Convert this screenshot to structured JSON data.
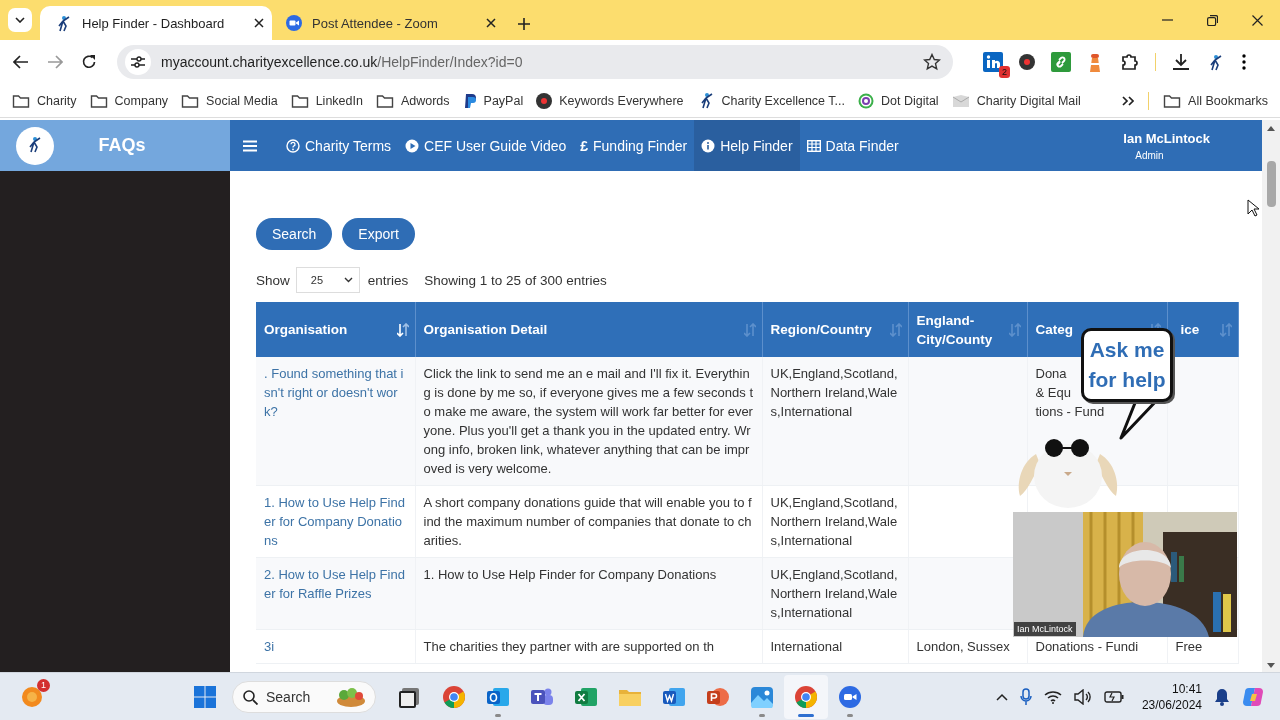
{
  "browser": {
    "tabs": [
      {
        "title": "Help Finder - Dashboard",
        "kind": "figure",
        "selected": true
      },
      {
        "title": "Post Attendee - Zoom",
        "kind": "zoom",
        "selected": false
      }
    ],
    "address": {
      "host": "myaccount.charityexcellence.co.uk",
      "path": "/HelpFinder/Index?id=0"
    },
    "extensions": [
      {
        "kind": "linkedin",
        "badge": "2"
      },
      {
        "kind": "k"
      },
      {
        "kind": "link"
      },
      {
        "kind": "lighthouse"
      },
      {
        "kind": "puzzle"
      }
    ],
    "bookmarks": [
      {
        "label": "Charity",
        "kind": "folder"
      },
      {
        "label": "Company",
        "kind": "folder"
      },
      {
        "label": "Social Media",
        "kind": "folder"
      },
      {
        "label": "LinkedIn",
        "kind": "folder"
      },
      {
        "label": "Adwords",
        "kind": "folder"
      },
      {
        "label": "PayPal",
        "kind": "paypal"
      },
      {
        "label": "Keywords Everywhere",
        "kind": "k"
      },
      {
        "label": "Charity Excellence T...",
        "kind": "figure"
      },
      {
        "label": "Dot Digital",
        "kind": "target"
      },
      {
        "label": "Charity Digital Mail",
        "kind": "page"
      }
    ],
    "all_bookmarks": "All Bookmarks"
  },
  "app": {
    "brand": "FAQs",
    "nav": [
      {
        "label": "Charity Terms",
        "kind": "question",
        "selected": false
      },
      {
        "label": "CEF User Guide Video",
        "kind": "play",
        "selected": false
      },
      {
        "label": "Funding Finder",
        "kind": "symbol",
        "symbol": "£",
        "selected": false
      },
      {
        "label": "Help Finder",
        "kind": "info",
        "selected": true
      },
      {
        "label": "Data Finder",
        "kind": "table",
        "selected": false
      }
    ],
    "user": {
      "name": "Ian McLintock",
      "role": "Admin"
    }
  },
  "toolbar": {
    "buttons": [
      "Search",
      "Export"
    ],
    "length": {
      "label": "Show",
      "value": "25",
      "suffix": "entries"
    },
    "info": "Showing 1 to 25 of 300 entries"
  },
  "table": {
    "columns": [
      {
        "label": "Organisation",
        "sorted": true
      },
      {
        "label": "Organisation Detail",
        "sorted": false
      },
      {
        "label": "Region/Country",
        "sorted": false
      },
      {
        "label": "England-City/County",
        "sorted": false
      },
      {
        "label": "Categ",
        "sorted": false
      },
      {
        "label": "ice",
        "sorted": false
      }
    ],
    "rows": [
      {
        "organisation": ". Found something that isn't right or doesn't work?",
        "detail": "Click the link to send me an e mail and I'll fix it. Everything is done by me so, if everyone gives me a few seconds to make me aware, the system will work far better for everyone. Plus you'll get a thank you in the updated entry. Wrong info, broken link, whatever anything that can be improved is very welcome.",
        "region": "UK,England,Scotland,Northern Ireland,Wales,International",
        "category": "Dona\n& Equ\ntions - Fund"
      },
      {
        "organisation": "1. How to Use Help Finder for Company Donations",
        "detail": "A short company donations guide that will enable you to find the maximum number of companies that donate to charities.",
        "region": "UK,England,Scotland,Northern Ireland,Wales,International"
      },
      {
        "organisation": "2. How to Use Help Finder for Raffle Prizes",
        "detail": "1. How to Use Help Finder for Company Donations",
        "region": "UK,England,Scotland,Northern Ireland,Wales,International"
      },
      {
        "organisation": "3i",
        "detail": "The charities they partner with are supported on th",
        "region": "International",
        "city": "London, Sussex",
        "category": "Donations - Fundi",
        "price": "Free"
      }
    ]
  },
  "help_bubble": {
    "text": "Ask me for help"
  },
  "video": {
    "name_tag": "Ian McLintock"
  },
  "taskbar": {
    "notification_badge": "1",
    "search_placeholder": "Search",
    "apps": [
      {
        "kind": "stack",
        "open": false,
        "active": false
      },
      {
        "kind": "chrome",
        "open": false,
        "active": false
      },
      {
        "kind": "outlook",
        "open": true,
        "active": false
      },
      {
        "kind": "teams",
        "open": false,
        "active": false
      },
      {
        "kind": "excel",
        "open": false,
        "active": false
      },
      {
        "kind": "folder",
        "open": false,
        "active": false
      },
      {
        "kind": "word",
        "open": false,
        "active": false
      },
      {
        "kind": "powerpoint",
        "open": false,
        "active": false
      },
      {
        "kind": "photos",
        "open": true,
        "active": false
      },
      {
        "kind": "chrome",
        "open": true,
        "active": true
      },
      {
        "kind": "zoom",
        "open": true,
        "active": false
      }
    ],
    "time": "10:41",
    "date": "23/06/2024"
  }
}
